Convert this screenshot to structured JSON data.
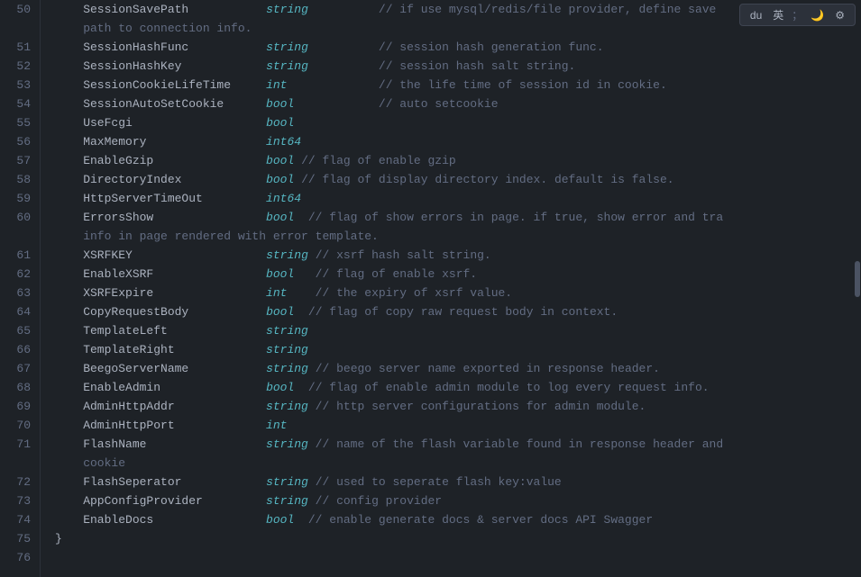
{
  "toolbar": {
    "items": [
      "英",
      "；",
      "🌙",
      "⚙"
    ]
  },
  "lines": [
    {
      "number": "50",
      "content": [
        {
          "type": "field",
          "text": "    SessionSavePath"
        },
        {
          "type": "space",
          "text": "           "
        },
        {
          "type": "type-string",
          "text": "string"
        },
        {
          "type": "space",
          "text": "          "
        },
        {
          "type": "comment",
          "text": "// if use mysql/redis/file provider, define save"
        }
      ]
    },
    {
      "number": "",
      "continuation": true,
      "content": [
        {
          "type": "comment",
          "text": "    path to connection info."
        }
      ]
    },
    {
      "number": "51",
      "content": [
        {
          "type": "field",
          "text": "    SessionHashFunc"
        },
        {
          "type": "space",
          "text": "           "
        },
        {
          "type": "type-string",
          "text": "string"
        },
        {
          "type": "space",
          "text": "          "
        },
        {
          "type": "comment",
          "text": "// session hash generation func."
        }
      ]
    },
    {
      "number": "52",
      "content": [
        {
          "type": "field",
          "text": "    SessionHashKey"
        },
        {
          "type": "space",
          "text": "            "
        },
        {
          "type": "type-string",
          "text": "string"
        },
        {
          "type": "space",
          "text": "          "
        },
        {
          "type": "comment",
          "text": "// session hash salt string."
        }
      ]
    },
    {
      "number": "53",
      "content": [
        {
          "type": "field",
          "text": "    SessionCookieLifeTime"
        },
        {
          "type": "space",
          "text": "     "
        },
        {
          "type": "type-int",
          "text": "int"
        },
        {
          "type": "space",
          "text": "             "
        },
        {
          "type": "comment",
          "text": "// the life time of session id in cookie."
        }
      ]
    },
    {
      "number": "54",
      "content": [
        {
          "type": "field",
          "text": "    SessionAutoSetCookie"
        },
        {
          "type": "space",
          "text": "      "
        },
        {
          "type": "type-bool",
          "text": "bool"
        },
        {
          "type": "space",
          "text": "            "
        },
        {
          "type": "comment",
          "text": "// auto setcookie"
        }
      ]
    },
    {
      "number": "55",
      "content": [
        {
          "type": "field",
          "text": "    UseFcgi"
        },
        {
          "type": "space",
          "text": "                   "
        },
        {
          "type": "type-bool",
          "text": "bool"
        },
        {
          "type": "space",
          "text": "            "
        },
        {
          "type": "comment",
          "text": ""
        }
      ]
    },
    {
      "number": "56",
      "content": [
        {
          "type": "field",
          "text": "    MaxMemory"
        },
        {
          "type": "space",
          "text": "                 "
        },
        {
          "type": "type-int64",
          "text": "int64"
        },
        {
          "type": "space",
          "text": "           "
        },
        {
          "type": "comment",
          "text": ""
        }
      ]
    },
    {
      "number": "57",
      "content": [
        {
          "type": "field",
          "text": "    EnableGzip"
        },
        {
          "type": "space",
          "text": "                "
        },
        {
          "type": "type-bool",
          "text": "bool"
        },
        {
          "type": "space",
          "text": " "
        },
        {
          "type": "comment",
          "text": "// flag of enable gzip"
        }
      ]
    },
    {
      "number": "58",
      "content": [
        {
          "type": "field",
          "text": "    DirectoryIndex"
        },
        {
          "type": "space",
          "text": "            "
        },
        {
          "type": "type-bool",
          "text": "bool"
        },
        {
          "type": "space",
          "text": " "
        },
        {
          "type": "comment",
          "text": "// flag of display directory index. default is false."
        }
      ]
    },
    {
      "number": "59",
      "content": [
        {
          "type": "field",
          "text": "    HttpServerTimeOut"
        },
        {
          "type": "space",
          "text": "         "
        },
        {
          "type": "type-int64",
          "text": "int64"
        },
        {
          "type": "space",
          "text": "           "
        },
        {
          "type": "comment",
          "text": ""
        }
      ]
    },
    {
      "number": "60",
      "content": [
        {
          "type": "field",
          "text": "    ErrorsShow"
        },
        {
          "type": "space",
          "text": "                "
        },
        {
          "type": "type-bool",
          "text": "bool"
        },
        {
          "type": "space",
          "text": "  "
        },
        {
          "type": "comment",
          "text": "// flag of show errors in page. if true, show error and tra"
        }
      ]
    },
    {
      "number": "",
      "continuation": true,
      "content": [
        {
          "type": "comment",
          "text": "    info in page rendered with error template."
        }
      ]
    },
    {
      "number": "61",
      "content": [
        {
          "type": "field",
          "text": "    XSRFKEY"
        },
        {
          "type": "space",
          "text": "                   "
        },
        {
          "type": "type-string",
          "text": "string"
        },
        {
          "type": "space",
          "text": " "
        },
        {
          "type": "comment",
          "text": "// xsrf hash salt string."
        }
      ]
    },
    {
      "number": "62",
      "content": [
        {
          "type": "field",
          "text": "    EnableXSRF"
        },
        {
          "type": "space",
          "text": "                "
        },
        {
          "type": "type-bool",
          "text": "bool"
        },
        {
          "type": "space",
          "text": "   "
        },
        {
          "type": "comment",
          "text": "// flag of enable xsrf."
        }
      ]
    },
    {
      "number": "63",
      "content": [
        {
          "type": "field",
          "text": "    XSRFExpire"
        },
        {
          "type": "space",
          "text": "                "
        },
        {
          "type": "type-int",
          "text": "int"
        },
        {
          "type": "space",
          "text": "    "
        },
        {
          "type": "comment",
          "text": "// the expiry of xsrf value."
        }
      ]
    },
    {
      "number": "64",
      "content": [
        {
          "type": "field",
          "text": "    CopyRequestBody"
        },
        {
          "type": "space",
          "text": "           "
        },
        {
          "type": "type-bool",
          "text": "bool"
        },
        {
          "type": "space",
          "text": "  "
        },
        {
          "type": "comment",
          "text": "// flag of copy raw request body in context."
        }
      ]
    },
    {
      "number": "65",
      "content": [
        {
          "type": "field",
          "text": "    TemplateLeft"
        },
        {
          "type": "space",
          "text": "              "
        },
        {
          "type": "type-string",
          "text": "string"
        },
        {
          "type": "space",
          "text": "          "
        },
        {
          "type": "comment",
          "text": ""
        }
      ]
    },
    {
      "number": "66",
      "content": [
        {
          "type": "field",
          "text": "    TemplateRight"
        },
        {
          "type": "space",
          "text": "             "
        },
        {
          "type": "type-string",
          "text": "string"
        },
        {
          "type": "space",
          "text": "          "
        },
        {
          "type": "comment",
          "text": ""
        }
      ]
    },
    {
      "number": "67",
      "content": [
        {
          "type": "field",
          "text": "    BeegoServerName"
        },
        {
          "type": "space",
          "text": "           "
        },
        {
          "type": "type-string",
          "text": "string"
        },
        {
          "type": "space",
          "text": " "
        },
        {
          "type": "comment",
          "text": "// beego server name exported in response header."
        }
      ]
    },
    {
      "number": "68",
      "content": [
        {
          "type": "field",
          "text": "    EnableAdmin"
        },
        {
          "type": "space",
          "text": "               "
        },
        {
          "type": "type-bool",
          "text": "bool"
        },
        {
          "type": "space",
          "text": "  "
        },
        {
          "type": "comment",
          "text": "// flag of enable admin module to log every request info."
        }
      ]
    },
    {
      "number": "69",
      "content": [
        {
          "type": "field",
          "text": "    AdminHttpAddr"
        },
        {
          "type": "space",
          "text": "             "
        },
        {
          "type": "type-string",
          "text": "string"
        },
        {
          "type": "space",
          "text": " "
        },
        {
          "type": "comment",
          "text": "// http server configurations for admin module."
        }
      ]
    },
    {
      "number": "70",
      "content": [
        {
          "type": "field",
          "text": "    AdminHttpPort"
        },
        {
          "type": "space",
          "text": "             "
        },
        {
          "type": "type-int",
          "text": "int"
        },
        {
          "type": "space",
          "text": "             "
        },
        {
          "type": "comment",
          "text": ""
        }
      ]
    },
    {
      "number": "71",
      "content": [
        {
          "type": "field",
          "text": "    FlashName"
        },
        {
          "type": "space",
          "text": "                 "
        },
        {
          "type": "type-string",
          "text": "string"
        },
        {
          "type": "space",
          "text": " "
        },
        {
          "type": "comment",
          "text": "// name of the flash variable found in response header and"
        }
      ]
    },
    {
      "number": "",
      "continuation": true,
      "content": [
        {
          "type": "comment",
          "text": "    cookie"
        }
      ]
    },
    {
      "number": "72",
      "content": [
        {
          "type": "field",
          "text": "    FlashSeperator"
        },
        {
          "type": "space",
          "text": "            "
        },
        {
          "type": "type-string",
          "text": "string"
        },
        {
          "type": "space",
          "text": " "
        },
        {
          "type": "comment",
          "text": "// used to seperate flash key:value"
        }
      ]
    },
    {
      "number": "73",
      "content": [
        {
          "type": "field",
          "text": "    AppConfigProvider"
        },
        {
          "type": "space",
          "text": "         "
        },
        {
          "type": "type-string",
          "text": "string"
        },
        {
          "type": "space",
          "text": " "
        },
        {
          "type": "comment",
          "text": "// config provider"
        }
      ]
    },
    {
      "number": "74",
      "content": [
        {
          "type": "field",
          "text": "    EnableDocs"
        },
        {
          "type": "space",
          "text": "                "
        },
        {
          "type": "type-bool",
          "text": "bool"
        },
        {
          "type": "space",
          "text": "  "
        },
        {
          "type": "comment",
          "text": "// enable generate docs & server docs API Swagger"
        }
      ]
    },
    {
      "number": "75",
      "content": [
        {
          "type": "bracket",
          "text": "}"
        }
      ]
    },
    {
      "number": "76",
      "content": []
    }
  ]
}
